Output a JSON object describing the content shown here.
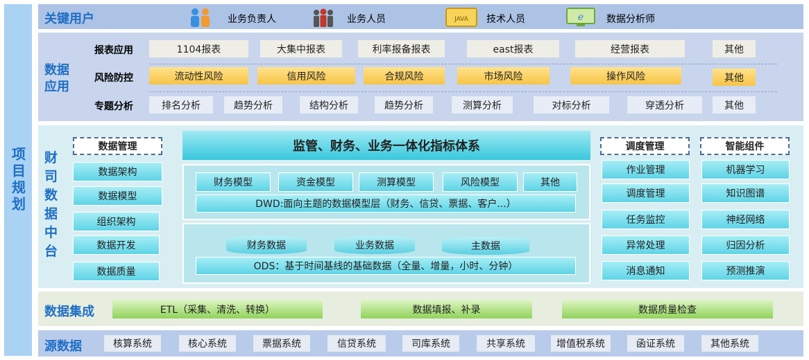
{
  "project": "项目规划",
  "users": {
    "title": "关键用户",
    "items": [
      {
        "label": "业务负责人",
        "icon": "people-orange-blue-icon"
      },
      {
        "label": "业务人员",
        "icon": "people-group-icon"
      },
      {
        "label": "技术人员",
        "icon": "java-screen-icon"
      },
      {
        "label": "数据分析师",
        "icon": "ie-monitor-icon"
      }
    ]
  },
  "data_app": {
    "title": "数据应用",
    "rows": [
      {
        "name": "报表应用",
        "items": [
          "1104报表",
          "大集中报表",
          "利率报备报表",
          "east报表",
          "经营报表",
          "其他"
        ]
      },
      {
        "name": "风险防控",
        "items": [
          "流动性风险",
          "信用风险",
          "合规风险",
          "市场风险",
          "操作风险",
          "其他"
        ]
      },
      {
        "name": "专题分析",
        "items": [
          "排名分析",
          "趋势分析",
          "结构分析",
          "趋势分析",
          "测算分析",
          "对标分析",
          "穿透分析",
          "其他"
        ]
      }
    ]
  },
  "platform": {
    "title": "财司数据中台",
    "data_mgmt": {
      "title": "数据管理",
      "items": [
        "数据架构",
        "数据模型",
        "组织架构",
        "数据开发",
        "数据质量"
      ]
    },
    "center_title": "监管、财务、业务一体化指标体系",
    "models": [
      "财务模型",
      "资金模型",
      "测算模型",
      "风险模型",
      "其他"
    ],
    "dwd": "DWD:面向主题的数据模型层（财务、信贷、票据、客户...）",
    "ods_sources": [
      "财务数据",
      "业务数据",
      "主数据"
    ],
    "ods": "ODS：基于时间基线的基础数据（全量、增量，小时、分钟）",
    "schedule": {
      "title": "调度管理",
      "items": [
        "作业管理",
        "调度管理",
        "任务监控",
        "异常处理",
        "消息通知"
      ]
    },
    "smart": {
      "title": "智能组件",
      "items": [
        "机器学习",
        "知识图谱",
        "神经网络",
        "归因分析",
        "预测推演"
      ]
    }
  },
  "integration": {
    "title": "数据集成",
    "items": [
      "ETL（采集、清洗、转换）",
      "数据填报、补录",
      "数据质量检查"
    ]
  },
  "source": {
    "title": "源数据",
    "items": [
      "核算系统",
      "核心系统",
      "票据系统",
      "信贷系统",
      "司库系统",
      "共享系统",
      "增值税系统",
      "函证系统",
      "其他系统"
    ]
  },
  "colors": {
    "accent": "#1f6fc5",
    "left_bar": "#a9d2f3",
    "users_bg": "#adc3e6",
    "app_bg": "#c8d5ec",
    "platform_bg": "#d9eef2",
    "integration_bg": "#e7eedf",
    "source_bg": "#b9cbea"
  }
}
